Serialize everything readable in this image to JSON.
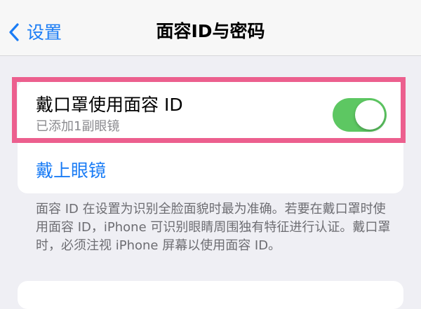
{
  "nav": {
    "back_label": "设置",
    "title": "面容ID与密码"
  },
  "mask_row": {
    "title": "戴口罩使用面容 ID",
    "subtitle": "已添加1副眼镜",
    "toggle_on": true
  },
  "glasses_link": "戴上眼镜",
  "footer_text": "面容 ID 在设置为识别全脸面貌时最为准确。若要在戴口罩时使用面容 ID，iPhone 可识别眼睛周围独有特征进行认证。戴口罩时，必须注视 iPhone 屏幕以使用面容 ID。",
  "colors": {
    "accent": "#1a7cf5",
    "toggle_on": "#5dc762",
    "highlight_border": "#ec5f8e"
  },
  "icons": {
    "back": "chevron-left-icon"
  }
}
